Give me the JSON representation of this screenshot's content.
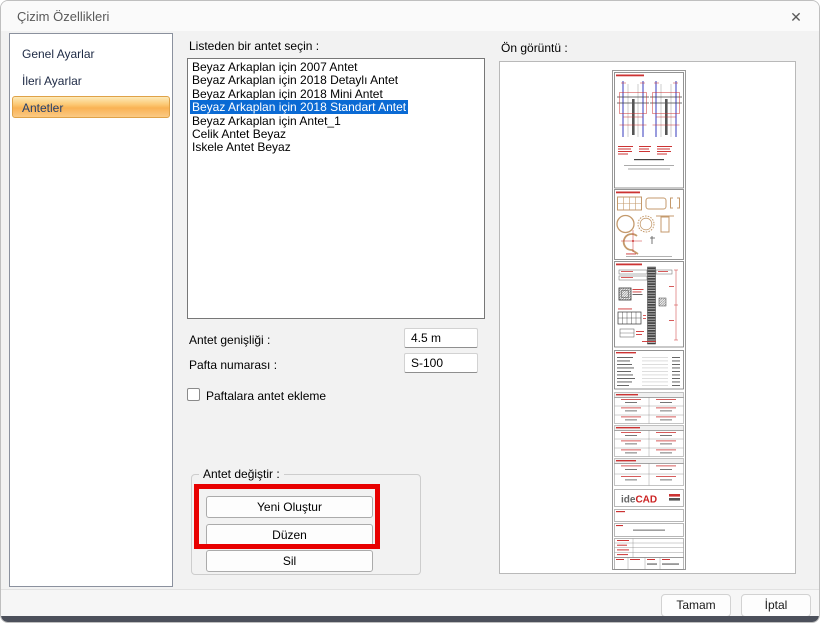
{
  "window": {
    "title": "Çizim Özellikleri",
    "close_icon": "✕"
  },
  "sidebar": {
    "items": [
      {
        "label": "Genel Ayarlar",
        "selected": false
      },
      {
        "label": "İleri Ayarlar",
        "selected": false
      },
      {
        "label": "Antetler",
        "selected": true
      }
    ]
  },
  "main": {
    "list_label": "Listeden bir antet seçin :",
    "list": {
      "items": [
        "Beyaz Arkaplan için 2007 Antet",
        "Beyaz Arkaplan için 2018 Detaylı Antet",
        "Beyaz Arkaplan için 2018 Mini Antet",
        "Beyaz Arkaplan için 2018 Standart Antet",
        "Beyaz Arkaplan için Antet_1",
        "Celik Antet Beyaz",
        "Iskele Antet Beyaz"
      ],
      "selected_index": 3,
      "selected_item": "Beyaz Arkaplan için 2018 Standart Antet"
    },
    "fields": {
      "width_label": "Antet genişliği :",
      "width_value": "4.5 m",
      "sheet_label": "Pafta numarası :",
      "sheet_value": "S-100"
    },
    "checkbox": {
      "label": "Paftalara antet ekleme",
      "checked": false
    },
    "group": {
      "label": "Antet değiştir :",
      "buttons": {
        "new": "Yeni Oluştur",
        "edit": "Düzen",
        "delete": "Sil"
      }
    }
  },
  "preview": {
    "label": "Ön görüntü :",
    "logo": {
      "ide": "ide",
      "cad": "CAD"
    }
  },
  "footer": {
    "ok_label": "Tamam",
    "cancel_label": "İptal"
  },
  "colors": {
    "selection_blue": "#0a6ad4",
    "annotation_red": "#e80000",
    "sidebar_active_border": "#dfa248",
    "sidebar_active_gradient_top": "#fdeab9",
    "sidebar_active_gradient_bottom": "#f9b254",
    "drawing_red": "#cc3333",
    "drawing_blue": "#8083d6",
    "drawing_tan": "#c49a6c"
  }
}
